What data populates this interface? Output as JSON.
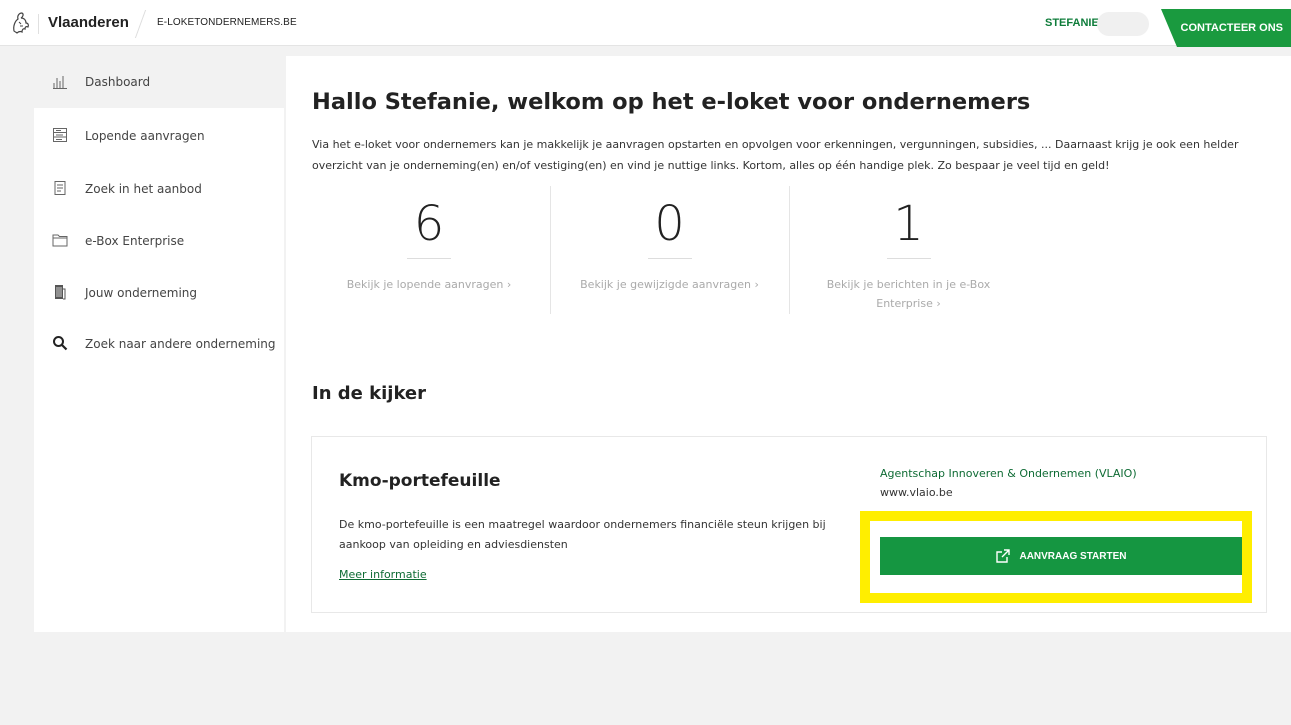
{
  "header": {
    "logo_icon": "flemish-lion-logo-icon",
    "brand": "Vlaanderen",
    "domain": "E-LOKETONDERNEMERS.BE",
    "user_name": "STEFANIE",
    "contact_label": "CONTACTEER ONS",
    "accent_color": "#1a9a3f"
  },
  "sidebar": {
    "items": [
      {
        "label": "Dashboard",
        "icon": "bar-chart-icon",
        "active": true
      },
      {
        "label": "Lopende aanvragen",
        "icon": "list-icon",
        "active": false
      },
      {
        "label": "Zoek in het aanbod",
        "icon": "document-icon",
        "active": false
      },
      {
        "label": "e-Box Enterprise",
        "icon": "folder-icon",
        "active": false
      },
      {
        "label": "Jouw onderneming",
        "icon": "building-icon",
        "active": false
      },
      {
        "label": "Zoek naar andere onderneming",
        "icon": "search-icon",
        "active": false
      }
    ]
  },
  "main": {
    "welcome": "Hallo Stefanie, welkom op het e-loket voor ondernemers",
    "intro": "Via het e-loket voor ondernemers kan je makkelijk je aanvragen opstarten en opvolgen voor erkenningen, vergunningen, subsidies, ... Daarnaast krijg je ook een helder overzicht van je onderneming(en) en/of vestiging(en) en vind je nuttige links. Kortom, alles op één handige plek. Zo bespaar je veel tijd en geld!",
    "stats": [
      {
        "value": "6",
        "link": "Bekijk je lopende aanvragen ›"
      },
      {
        "value": "0",
        "link": "Bekijk je gewijzigde aanvragen ›"
      },
      {
        "value": "1",
        "link": "Bekijk je berichten in je e-Box Enterprise ›"
      }
    ],
    "spotlight_title": "In de kijker",
    "card": {
      "title": "Kmo-portefeuille",
      "description": "De kmo-portefeuille is een maatregel waardoor ondernemers financiële steun krijgen bij aankoop van opleiding en adviesdiensten",
      "more_link": "Meer informatie",
      "agency": "Agentschap Innoveren & Ondernemen (VLAIO)",
      "agency_url": "www.vlaio.be",
      "button_label": "AANVRAAG STARTEN",
      "button_icon": "external-link-icon",
      "highlight_color": "#ffee00"
    }
  }
}
